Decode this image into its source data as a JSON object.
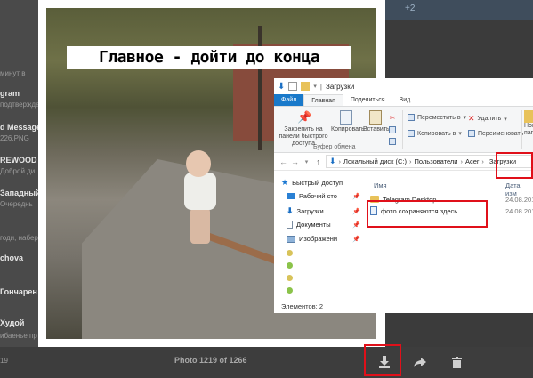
{
  "background": {
    "top_counter": "+2",
    "top_left_partial": "gram",
    "chat_list": [
      {
        "title": "",
        "subtitle": "минут в"
      },
      {
        "title": "gram",
        "subtitle": "подтвержде"
      },
      {
        "title": "d Message",
        "subtitle": "226.PNG"
      },
      {
        "title": "REWOOD |",
        "subtitle": "Доброй ди"
      },
      {
        "title": "Западный",
        "subtitle": "Очереднь"
      },
      {
        "title": "",
        "subtitle": "годи, набер"
      },
      {
        "title": "chova",
        "subtitle": ""
      },
      {
        "title": "Гончарен",
        "subtitle": ""
      },
      {
        "title": "Худой",
        "subtitle": "ибаенье пр"
      }
    ]
  },
  "photo": {
    "caption": "Главное - дойти до конца"
  },
  "explorer": {
    "window_title": "Загрузки",
    "tabs": [
      "Файл",
      "Главная",
      "Поделиться",
      "Вид"
    ],
    "ribbon": {
      "pin_label": "Закрепить на панели быстрого доступа",
      "copy_label": "Копировать",
      "paste_label": "Вставить",
      "move_to": "Переместить в",
      "copy_to": "Копировать в",
      "delete": "Удалить",
      "rename": "Переименовать",
      "new_partial": "Нов пап",
      "group_clipboard": "Буфер обмена"
    },
    "address": {
      "crumbs": [
        "Локальный диск (C:)",
        "Пользователи",
        "Acer"
      ],
      "current": "Загрузки"
    },
    "nav": [
      {
        "label": "Быстрый доступ",
        "icon": "star-icon"
      },
      {
        "label": "Рабочий сто",
        "icon": "desktop-icon"
      },
      {
        "label": "Загрузки",
        "icon": "download-icon"
      },
      {
        "label": "Документы",
        "icon": "documents-icon"
      },
      {
        "label": "Изображени",
        "icon": "pictures-icon"
      }
    ],
    "columns": {
      "name": "Имя",
      "date": "Дата изм"
    },
    "files": [
      {
        "name": "Telegram Desktop",
        "date": "24.08.201",
        "type": "folder"
      },
      {
        "name": "фото сохраняются здесь",
        "date": "24.08.201",
        "type": "file"
      }
    ],
    "status": "Элементов: 2"
  },
  "viewer": {
    "left_counter": "19",
    "counter": "Photo 1219 of 1266",
    "download_icon": "download-icon",
    "forward_icon": "forward-icon",
    "delete_icon": "trash-icon"
  },
  "colors": {
    "highlight": "#e0101a",
    "explorer_accent": "#1979ca"
  }
}
